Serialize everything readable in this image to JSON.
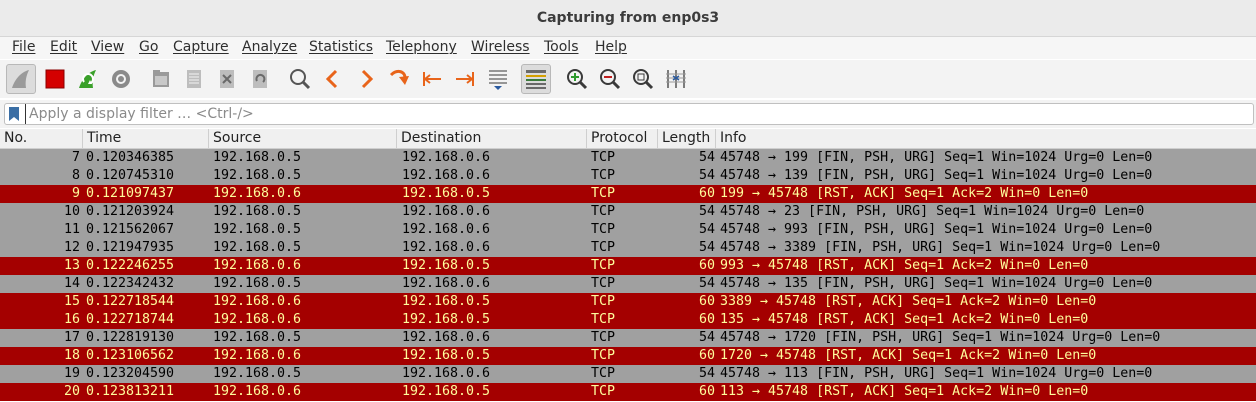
{
  "window": {
    "title": "Capturing from enp0s3"
  },
  "menu": [
    "File",
    "Edit",
    "View",
    "Go",
    "Capture",
    "Analyze",
    "Statistics",
    "Telephony",
    "Wireless",
    "Tools",
    "Help"
  ],
  "toolbar": [
    {
      "name": "shark-fin-start-icon"
    },
    {
      "name": "stop-capture-icon"
    },
    {
      "name": "restart-capture-icon"
    },
    {
      "name": "capture-options-icon"
    },
    {
      "name": "open-file-icon"
    },
    {
      "name": "save-file-icon"
    },
    {
      "name": "close-file-icon"
    },
    {
      "name": "reload-file-icon"
    },
    {
      "name": "find-packet-icon"
    },
    {
      "name": "go-back-icon"
    },
    {
      "name": "go-forward-icon"
    },
    {
      "name": "go-to-packet-icon"
    },
    {
      "name": "go-first-packet-icon"
    },
    {
      "name": "go-last-packet-icon"
    },
    {
      "name": "auto-scroll-icon"
    },
    {
      "name": "colorize-icon"
    },
    {
      "name": "zoom-in-icon"
    },
    {
      "name": "zoom-out-icon"
    },
    {
      "name": "normal-size-icon"
    },
    {
      "name": "resize-columns-icon"
    }
  ],
  "filter": {
    "placeholder": "Apply a display filter … <Ctrl-/>",
    "value": ""
  },
  "columns": [
    "No.",
    "Time",
    "Source",
    "Destination",
    "Protocol",
    "Length",
    "Info"
  ],
  "packets": [
    {
      "no": "7",
      "time": "0.120346385",
      "src": "192.168.0.5",
      "dst": "192.168.0.6",
      "proto": "TCP",
      "len": "54",
      "info": "45748 → 199 [FIN, PSH, URG] Seq=1 Win=1024 Urg=0 Len=0",
      "kind": "tcp"
    },
    {
      "no": "8",
      "time": "0.120745310",
      "src": "192.168.0.5",
      "dst": "192.168.0.6",
      "proto": "TCP",
      "len": "54",
      "info": "45748 → 139 [FIN, PSH, URG] Seq=1 Win=1024 Urg=0 Len=0",
      "kind": "tcp"
    },
    {
      "no": "9",
      "time": "0.121097437",
      "src": "192.168.0.6",
      "dst": "192.168.0.5",
      "proto": "TCP",
      "len": "60",
      "info": "199 → 45748 [RST, ACK] Seq=1 Ack=2 Win=0 Len=0",
      "kind": "rst"
    },
    {
      "no": "10",
      "time": "0.121203924",
      "src": "192.168.0.5",
      "dst": "192.168.0.6",
      "proto": "TCP",
      "len": "54",
      "info": "45748 → 23 [FIN, PSH, URG] Seq=1 Win=1024 Urg=0 Len=0",
      "kind": "tcp"
    },
    {
      "no": "11",
      "time": "0.121562067",
      "src": "192.168.0.5",
      "dst": "192.168.0.6",
      "proto": "TCP",
      "len": "54",
      "info": "45748 → 993 [FIN, PSH, URG] Seq=1 Win=1024 Urg=0 Len=0",
      "kind": "tcp"
    },
    {
      "no": "12",
      "time": "0.121947935",
      "src": "192.168.0.5",
      "dst": "192.168.0.6",
      "proto": "TCP",
      "len": "54",
      "info": "45748 → 3389 [FIN, PSH, URG] Seq=1 Win=1024 Urg=0 Len=0",
      "kind": "tcp"
    },
    {
      "no": "13",
      "time": "0.122246255",
      "src": "192.168.0.6",
      "dst": "192.168.0.5",
      "proto": "TCP",
      "len": "60",
      "info": "993 → 45748 [RST, ACK] Seq=1 Ack=2 Win=0 Len=0",
      "kind": "rst"
    },
    {
      "no": "14",
      "time": "0.122342432",
      "src": "192.168.0.5",
      "dst": "192.168.0.6",
      "proto": "TCP",
      "len": "54",
      "info": "45748 → 135 [FIN, PSH, URG] Seq=1 Win=1024 Urg=0 Len=0",
      "kind": "tcp"
    },
    {
      "no": "15",
      "time": "0.122718544",
      "src": "192.168.0.6",
      "dst": "192.168.0.5",
      "proto": "TCP",
      "len": "60",
      "info": "3389 → 45748 [RST, ACK] Seq=1 Ack=2 Win=0 Len=0",
      "kind": "rst"
    },
    {
      "no": "16",
      "time": "0.122718744",
      "src": "192.168.0.6",
      "dst": "192.168.0.5",
      "proto": "TCP",
      "len": "60",
      "info": "135 → 45748 [RST, ACK] Seq=1 Ack=2 Win=0 Len=0",
      "kind": "rst"
    },
    {
      "no": "17",
      "time": "0.122819130",
      "src": "192.168.0.5",
      "dst": "192.168.0.6",
      "proto": "TCP",
      "len": "54",
      "info": "45748 → 1720 [FIN, PSH, URG] Seq=1 Win=1024 Urg=0 Len=0",
      "kind": "tcp"
    },
    {
      "no": "18",
      "time": "0.123106562",
      "src": "192.168.0.6",
      "dst": "192.168.0.5",
      "proto": "TCP",
      "len": "60",
      "info": "1720 → 45748 [RST, ACK] Seq=1 Ack=2 Win=0 Len=0",
      "kind": "rst"
    },
    {
      "no": "19",
      "time": "0.123204590",
      "src": "192.168.0.5",
      "dst": "192.168.0.6",
      "proto": "TCP",
      "len": "54",
      "info": "45748 → 113 [FIN, PSH, URG] Seq=1 Win=1024 Urg=0 Len=0",
      "kind": "tcp"
    },
    {
      "no": "20",
      "time": "0.123813211",
      "src": "192.168.0.6",
      "dst": "192.168.0.5",
      "proto": "TCP",
      "len": "60",
      "info": "113 → 45748 [RST, ACK] Seq=1 Ack=2 Win=0 Len=0",
      "kind": "rst"
    }
  ],
  "colors": {
    "tcp_row_bg": "#a0a0a0",
    "rst_row_bg": "#a40000",
    "rst_row_fg": "#fffc9c"
  }
}
